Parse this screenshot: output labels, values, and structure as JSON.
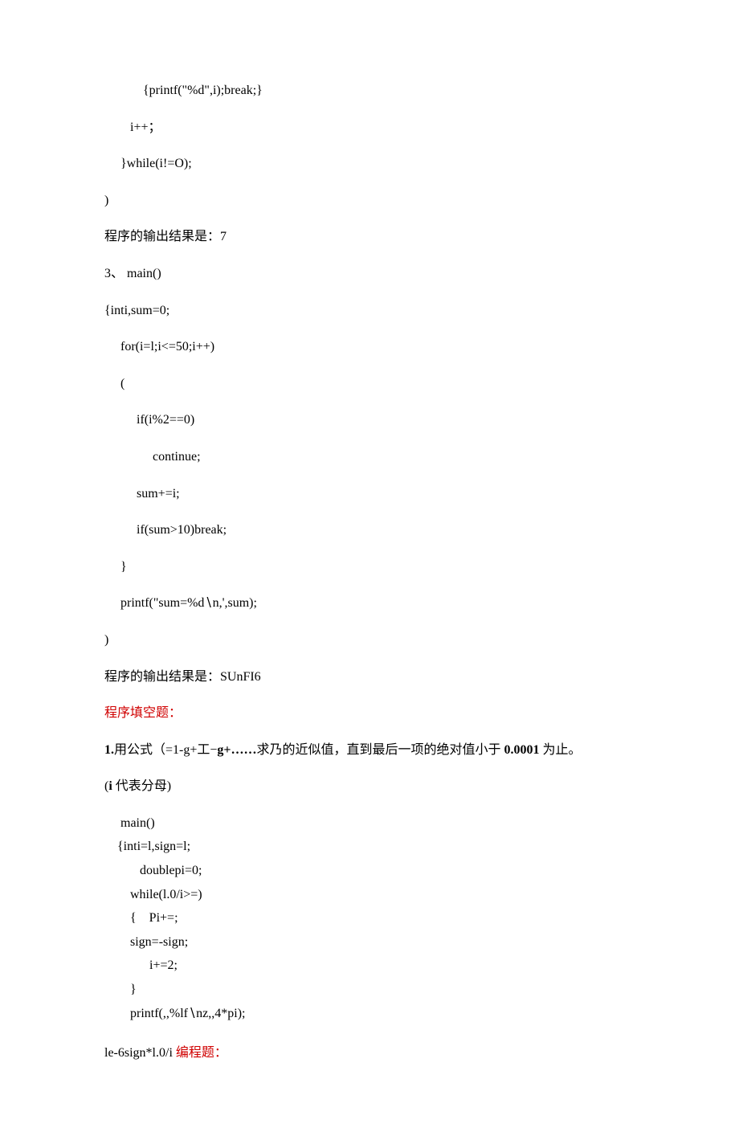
{
  "lines": [
    {
      "cls": "line",
      "text": "            {printf(\"%d\",i);break;}"
    },
    {
      "cls": "line",
      "text": "        i++；"
    },
    {
      "cls": "line",
      "text": "     }while(i!=O);"
    },
    {
      "cls": "line",
      "text": ")"
    },
    {
      "cls": "line",
      "text": "程序的输出结果是：7"
    },
    {
      "cls": "line",
      "text": "3、 main()"
    },
    {
      "cls": "line",
      "text": "{inti,sum=0;"
    },
    {
      "cls": "line",
      "text": "     for(i=l;i<=50;i++)"
    },
    {
      "cls": "line",
      "text": "     ("
    },
    {
      "cls": "line",
      "text": "          if(i%2==0)"
    },
    {
      "cls": "line",
      "text": "               continue;"
    },
    {
      "cls": "line",
      "text": "          sum+=i;"
    },
    {
      "cls": "line",
      "text": "          if(sum>10)break;"
    },
    {
      "cls": "line",
      "text": "     }"
    },
    {
      "cls": "line",
      "text": "     printf(\"sum=%d∖n,',sum);"
    },
    {
      "cls": "line",
      "text": ")"
    },
    {
      "cls": "line",
      "text": "程序的输出结果是：SUnFI6"
    }
  ],
  "heading1": "程序填空题：",
  "formula_prefix": "1.",
  "formula_mid1": "用公式（=1-g+工−",
  "formula_bold1": "g+……",
  "formula_mid2": "求乃的近似值，直到最后一项的绝对值小于 ",
  "formula_bold2": "0.0001",
  "formula_mid3": " 为止。",
  "subhead_prefix": "(",
  "subhead_bold": "i ",
  "subhead_rest": "代表分母)",
  "code2": [
    "     main()",
    "    {inti=l,sign=l;",
    "           doublepi=0;",
    "        while(l.0/i>=)",
    "        {    Pi+=;",
    "        sign=-sign;",
    "              i+=2;",
    "        }",
    "        printf(,,%lf∖nz,,4*pi);"
  ],
  "tail_black": "le-6sign*l.0/i ",
  "tail_red": "编程题："
}
